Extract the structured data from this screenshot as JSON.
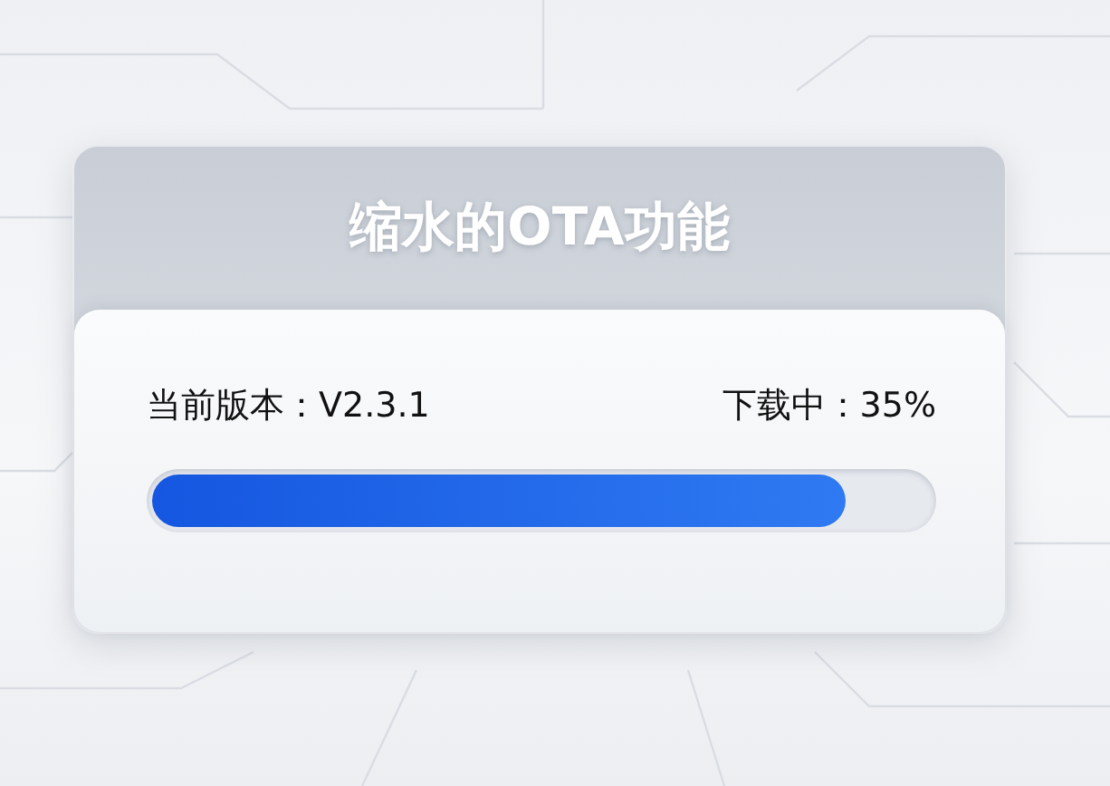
{
  "card": {
    "title": "缩水的OTA功能",
    "version_label": "当前版本：V2.3.1",
    "download_label": "下载中：35%",
    "progress": {
      "level": 0.89
    }
  }
}
